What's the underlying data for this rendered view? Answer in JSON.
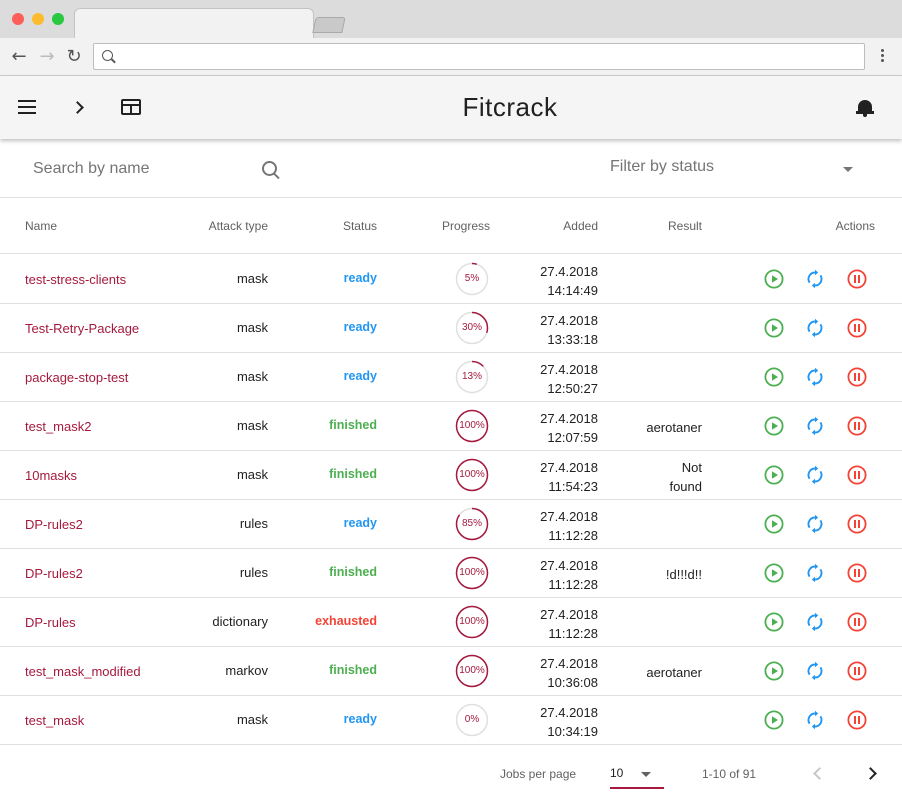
{
  "app": {
    "title": "Fitcrack"
  },
  "colors": {
    "accent": "#a5193e",
    "ready": "#2196f3",
    "finished": "#4caf50",
    "exhausted": "#f44336",
    "play": "#4caf50",
    "restart": "#2196f3",
    "pause": "#f44336"
  },
  "browser": {
    "address": ""
  },
  "filters": {
    "search_placeholder": "Search by name",
    "status_placeholder": "Filter by status"
  },
  "table": {
    "headers": {
      "name": "Name",
      "attack_type": "Attack type",
      "status": "Status",
      "progress": "Progress",
      "added": "Added",
      "result": "Result",
      "actions": "Actions"
    },
    "rows": [
      {
        "name": "test-stress-clients",
        "attack": "mask",
        "status": "ready",
        "progress": 5,
        "progress_label": "5%",
        "added_date": "27.4.2018",
        "added_time": "14:14:49",
        "result_1": "",
        "result_2": ""
      },
      {
        "name": "Test-Retry-Package",
        "attack": "mask",
        "status": "ready",
        "progress": 30,
        "progress_label": "30%",
        "added_date": "27.4.2018",
        "added_time": "13:33:18",
        "result_1": "",
        "result_2": ""
      },
      {
        "name": "package-stop-test",
        "attack": "mask",
        "status": "ready",
        "progress": 13,
        "progress_label": "13%",
        "added_date": "27.4.2018",
        "added_time": "12:50:27",
        "result_1": "",
        "result_2": ""
      },
      {
        "name": "test_mask2",
        "attack": "mask",
        "status": "finished",
        "progress": 100,
        "progress_label": "100%",
        "added_date": "27.4.2018",
        "added_time": "12:07:59",
        "result_1": "aerotaner",
        "result_2": ""
      },
      {
        "name": "10masks",
        "attack": "mask",
        "status": "finished",
        "progress": 100,
        "progress_label": "100%",
        "added_date": "27.4.2018",
        "added_time": "11:54:23",
        "result_1": "Not",
        "result_2": "found"
      },
      {
        "name": "DP-rules2",
        "attack": "rules",
        "status": "ready",
        "progress": 85,
        "progress_label": "85%",
        "added_date": "27.4.2018",
        "added_time": "11:12:28",
        "result_1": "",
        "result_2": ""
      },
      {
        "name": "DP-rules2",
        "attack": "rules",
        "status": "finished",
        "progress": 100,
        "progress_label": "100%",
        "added_date": "27.4.2018",
        "added_time": "11:12:28",
        "result_1": "!d!!!d!!",
        "result_2": ""
      },
      {
        "name": "DP-rules",
        "attack": "dictionary",
        "status": "exhausted",
        "progress": 100,
        "progress_label": "100%",
        "added_date": "27.4.2018",
        "added_time": "11:12:28",
        "result_1": "",
        "result_2": ""
      },
      {
        "name": "test_mask_modified",
        "attack": "markov",
        "status": "finished",
        "progress": 100,
        "progress_label": "100%",
        "added_date": "27.4.2018",
        "added_time": "10:36:08",
        "result_1": "aerotaner",
        "result_2": ""
      },
      {
        "name": "test_mask",
        "attack": "mask",
        "status": "ready",
        "progress": 0,
        "progress_label": "0%",
        "added_date": "27.4.2018",
        "added_time": "10:34:19",
        "result_1": "",
        "result_2": ""
      }
    ]
  },
  "pagination": {
    "per_page_label": "Jobs per page",
    "per_page_value": "10",
    "range": "1-10 of 91"
  },
  "icons": {
    "menu": "menu-icon",
    "chevron": "chevron-right-icon",
    "dashboard": "dashboard-icon",
    "bell": "bell-icon",
    "search": "search-icon",
    "play": "play-circle-icon",
    "restart": "restart-icon",
    "pause": "pause-circle-icon"
  }
}
